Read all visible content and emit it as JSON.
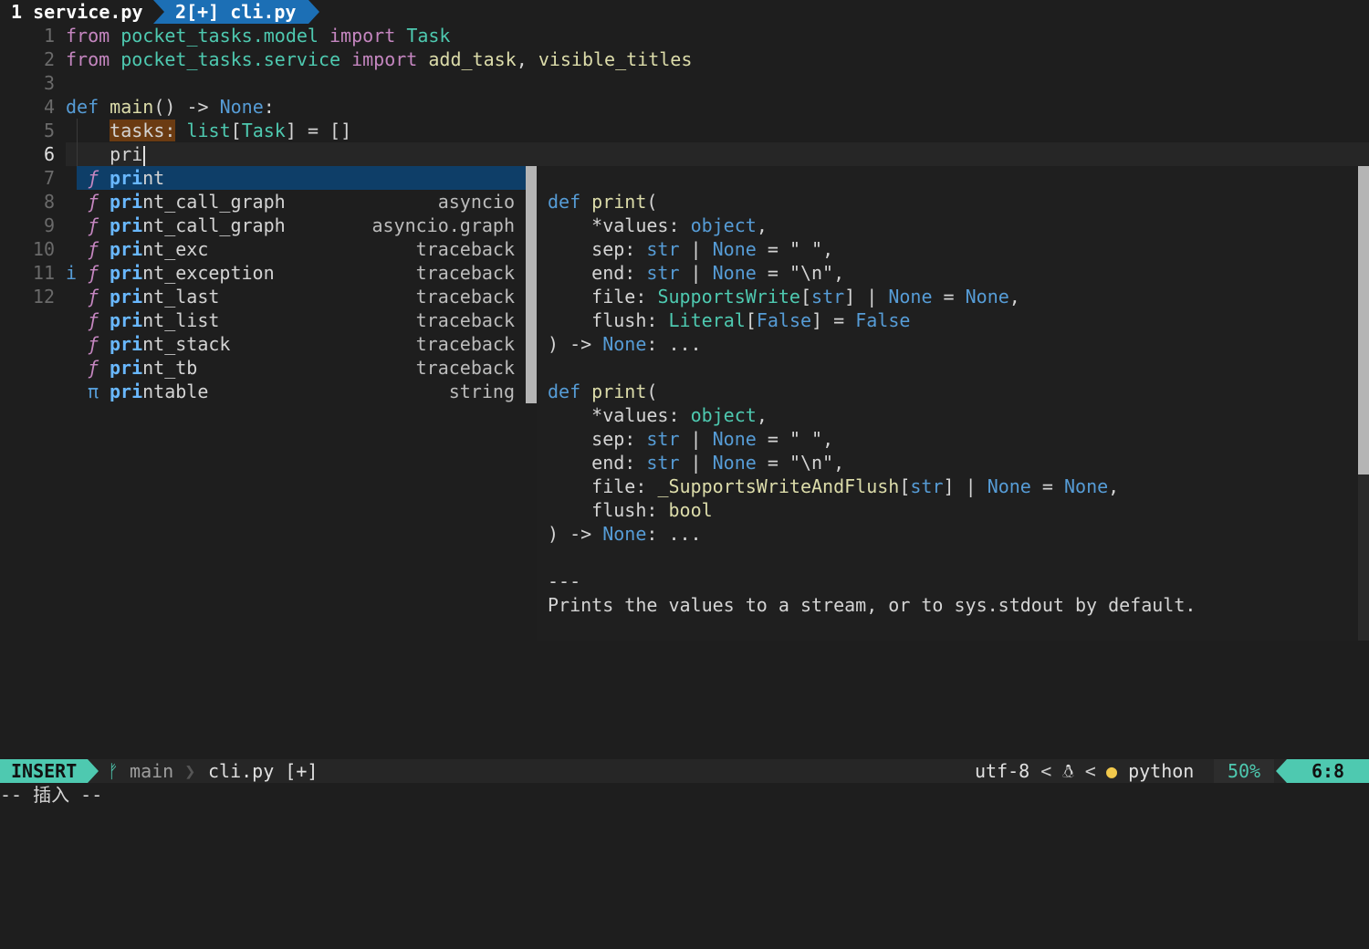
{
  "tabline": {
    "tab1": "1 service.py",
    "tab2": "2[+] cli.py"
  },
  "editor": {
    "line_numbers": [
      "1",
      "2",
      "3",
      "4",
      "5",
      "6",
      "7",
      "8",
      "9",
      "10",
      "11",
      "12"
    ],
    "sign_line11": "i",
    "line1": {
      "kw1": "from",
      "mod": "pocket_tasks.model",
      "kw2": "import",
      "name": "Task"
    },
    "line2": {
      "kw1": "from",
      "mod": "pocket_tasks.service",
      "kw2": "import",
      "name1": "add_task",
      "comma": ", ",
      "name2": "visible_titles"
    },
    "line4": {
      "kw": "def",
      "fn": "main",
      "paren": "() -> ",
      "ret": "None",
      "colon": ":"
    },
    "line5": {
      "var": "tasks:",
      "type1": "list",
      "br1": "[",
      "type2": "Task",
      "rest": "] = []"
    },
    "line6": {
      "typed": "pri"
    }
  },
  "completion": {
    "items": [
      {
        "kind": "ƒ",
        "match": "pri",
        "rest": "nt",
        "menu": "",
        "selected": true
      },
      {
        "kind": "ƒ",
        "match": "pri",
        "rest": "nt_call_graph",
        "menu": "asyncio"
      },
      {
        "kind": "ƒ",
        "match": "pri",
        "rest": "nt_call_graph",
        "menu": "asyncio.graph"
      },
      {
        "kind": "ƒ",
        "match": "pri",
        "rest": "nt_exc",
        "menu": "traceback"
      },
      {
        "kind": "ƒ",
        "match": "pri",
        "rest": "nt_exception",
        "menu": "traceback"
      },
      {
        "kind": "ƒ",
        "match": "pri",
        "rest": "nt_last",
        "menu": "traceback"
      },
      {
        "kind": "ƒ",
        "match": "pri",
        "rest": "nt_list",
        "menu": "traceback"
      },
      {
        "kind": "ƒ",
        "match": "pri",
        "rest": "nt_stack",
        "menu": "traceback"
      },
      {
        "kind": "ƒ",
        "match": "pri",
        "rest": "nt_tb",
        "menu": "traceback"
      },
      {
        "kind": "π",
        "match": "pri",
        "rest": "ntable",
        "menu": "string"
      }
    ]
  },
  "doc": {
    "sig1": {
      "def": "def",
      "name": "print",
      "open": "(",
      "p1": "*values",
      "p1t": "object",
      "p2": "sep",
      "p2t": "str",
      "p2n": "None",
      "p2v": "\" \"",
      "p3": "end",
      "p3t": "str",
      "p3n": "None",
      "p3v": "\"\\n\"",
      "p4": "file",
      "p4t": "SupportsWrite",
      "p4a": "str",
      "p4n": "None",
      "p4v": "None",
      "p5": "flush",
      "p5t": "Literal",
      "p5a": "False",
      "p5v": "False",
      "close": ") -> ",
      "ret": "None",
      "ell": ": ..."
    },
    "sig2": {
      "def": "def",
      "name": "print",
      "open": "(",
      "p1": "*values",
      "p1t": "object",
      "p2": "sep",
      "p2t": "str",
      "p2n": "None",
      "p2v": "\" \"",
      "p3": "end",
      "p3t": "str",
      "p3n": "None",
      "p3v": "\"\\n\"",
      "p4": "file",
      "p4t": "_SupportsWriteAndFlush",
      "p4a": "str",
      "p4n": "None",
      "p4v": "None",
      "p5": "flush",
      "p5t": "bool",
      "close": ") -> ",
      "ret": "None",
      "ell": ": ..."
    },
    "rule": "---",
    "description": "Prints the values to a stream, or to sys.stdout by default."
  },
  "statusline": {
    "mode": "INSERT",
    "branch_icon": "git-branch-icon",
    "branch": "main",
    "file": "cli.py [+]",
    "encoding": "utf-8",
    "os_icon": "linux-icon",
    "filetype_icon": "python-icon",
    "filetype": "python",
    "percent": "50%",
    "position": "6:8"
  },
  "cmdline": "-- 插入 --",
  "colors": {
    "background": "#1e1e1e",
    "keyword": "#c586c0",
    "module": "#4ec9b0",
    "function": "#dcdcaa",
    "builtin": "#569cd6",
    "tab_active": "#1c6fb5",
    "mode_bg": "#4ec9b0",
    "selection": "#0e3e68",
    "search_highlight": "#6b3b12"
  }
}
